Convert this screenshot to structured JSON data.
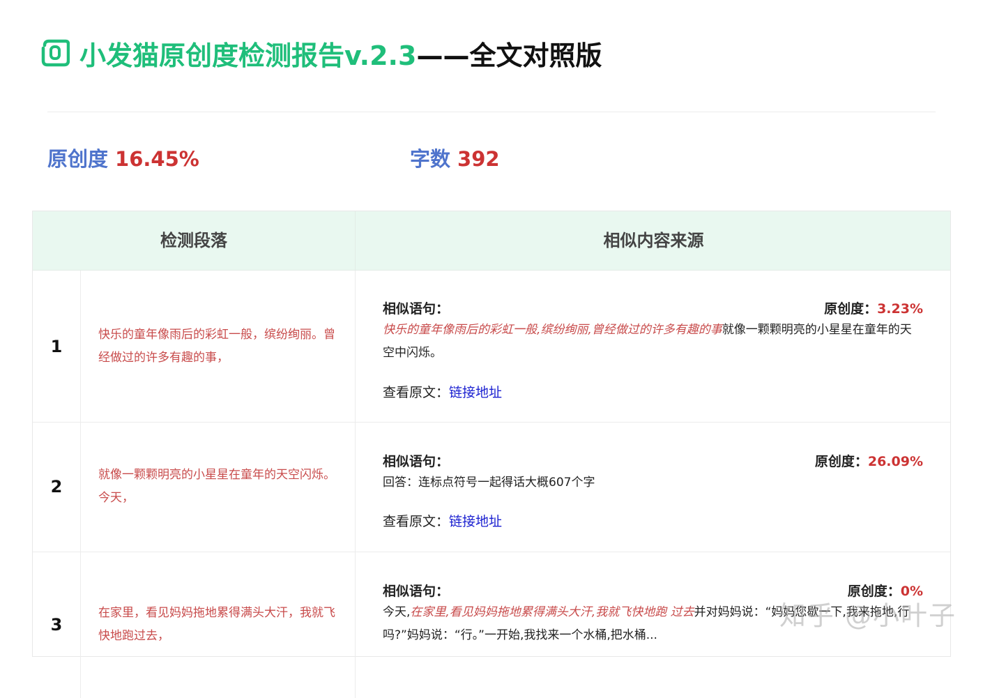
{
  "header": {
    "logo_icon": "document-logo-icon",
    "title_green": "小发猫原创度检测报告v.2.3",
    "title_black": "——全文对照版"
  },
  "stats": {
    "originality_label": "原创度",
    "originality_value": "16.45%",
    "word_count_label": "字数",
    "word_count_value": "392"
  },
  "table": {
    "headers": [
      "检测段落",
      "相似内容来源"
    ],
    "rows": [
      {
        "num": "1",
        "segment": "快乐的童年像雨后的彩虹一般，缤纷绚丽。曾经做过的许多有趣的事，",
        "sim_label": "相似语句：",
        "orig_label": "原创度：",
        "orig_value": "3.23%",
        "text_pre": "",
        "text_hl": "快乐的童年像雨后的彩虹一般,缤纷绚丽,曾经做过的许多有趣的事",
        "text_post": "就像一颗颗明亮的小星星在童年的天空中闪烁。",
        "link_label": "查看原文：",
        "link_text": "链接地址"
      },
      {
        "num": "2",
        "segment": "就像一颗颗明亮的小星星在童年的天空闪烁。今天，",
        "sim_label": "相似语句：",
        "orig_label": "原创度：",
        "orig_value": "26.09%",
        "text_pre": "回答：连标点符号一起得话大概607个字",
        "text_hl": "",
        "text_post": "",
        "link_label": "查看原文：",
        "link_text": "链接地址"
      },
      {
        "num": "3",
        "segment": "在家里，看见妈妈拖地累得满头大汗，我就飞快地跑过去，",
        "sim_label": "相似语句：",
        "orig_label": "原创度：",
        "orig_value": "0%",
        "text_pre": "今天,",
        "text_hl": "在家里,看见妈妈拖地累得满头大汗,我就飞快地跑 过去",
        "text_post": "并对妈妈说：“妈妈您歇一下,我来拖地,行吗?”妈妈说：“行。”一开始,我找来一个水桶,把水桶...",
        "link_label": "",
        "link_text": ""
      }
    ]
  },
  "watermark": "知乎 @小叶子"
}
